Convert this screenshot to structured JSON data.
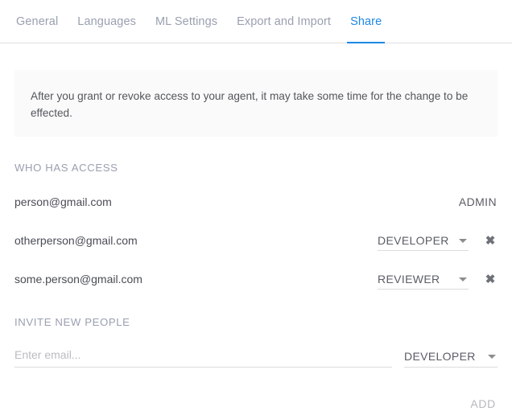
{
  "tabs": [
    {
      "label": "General",
      "active": false
    },
    {
      "label": "Languages",
      "active": false
    },
    {
      "label": "ML Settings",
      "active": false
    },
    {
      "label": "Export and Import",
      "active": false
    },
    {
      "label": "Share",
      "active": true
    }
  ],
  "notice": {
    "text": "After you grant or revoke access to your agent, it may take some time for the change to be effected."
  },
  "access_section": {
    "title": "WHO HAS ACCESS",
    "rows": [
      {
        "email": "person@gmail.com",
        "role": "ADMIN",
        "role_editable": false,
        "removable": false
      },
      {
        "email": "otherperson@gmail.com",
        "role": "DEVELOPER",
        "role_editable": true,
        "removable": true
      },
      {
        "email": "some.person@gmail.com",
        "role": "REVIEWER",
        "role_editable": true,
        "removable": true
      }
    ],
    "delete_icon": "✖"
  },
  "invite_section": {
    "title": "INVITE NEW PEOPLE",
    "email_placeholder": "Enter email...",
    "email_value": "",
    "role": "DEVELOPER",
    "add_label": "ADD"
  },
  "colors": {
    "accent": "#1e88e5",
    "tab_inactive": "#9aa0b0",
    "notice_bg": "#fafafa",
    "text": "#4a4d55",
    "muted": "#9aa0b0",
    "disabled": "#b5b8be",
    "divider": "#e0e0e0",
    "underline": "#dcdcdc"
  }
}
